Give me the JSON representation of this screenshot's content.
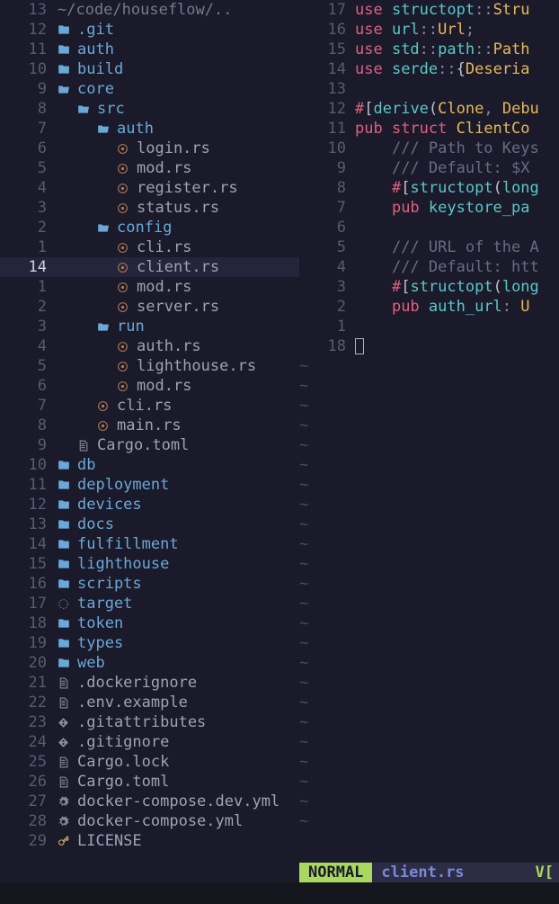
{
  "tree": {
    "header": {
      "num": "13",
      "path": "~/code/houseflow/.."
    },
    "rows": [
      {
        "num": "12",
        "indent": 0,
        "icon": "folder",
        "name": ".git",
        "cls": "folder-name"
      },
      {
        "num": "11",
        "indent": 0,
        "icon": "folder",
        "name": "auth",
        "cls": "folder-name"
      },
      {
        "num": "10",
        "indent": 0,
        "icon": "folder",
        "name": "build",
        "cls": "folder-name"
      },
      {
        "num": "9",
        "indent": 0,
        "icon": "folder-open",
        "name": "core",
        "cls": "folder-name"
      },
      {
        "num": "8",
        "indent": 1,
        "icon": "folder-open",
        "name": "src",
        "cls": "folder-name"
      },
      {
        "num": "7",
        "indent": 2,
        "icon": "folder-open",
        "name": "auth",
        "cls": "folder-name"
      },
      {
        "num": "6",
        "indent": 3,
        "icon": "rust",
        "name": "login.rs",
        "cls": "generic-name"
      },
      {
        "num": "5",
        "indent": 3,
        "icon": "rust",
        "name": "mod.rs",
        "cls": "generic-name"
      },
      {
        "num": "4",
        "indent": 3,
        "icon": "rust",
        "name": "register.rs",
        "cls": "generic-name"
      },
      {
        "num": "3",
        "indent": 3,
        "icon": "rust",
        "name": "status.rs",
        "cls": "generic-name"
      },
      {
        "num": "2",
        "indent": 2,
        "icon": "folder-open",
        "name": "config",
        "cls": "folder-name"
      },
      {
        "num": "1",
        "indent": 3,
        "icon": "rust",
        "name": "cli.rs",
        "cls": "generic-name"
      },
      {
        "num": "14",
        "indent": 3,
        "icon": "rust",
        "name": "client.rs",
        "cls": "generic-name",
        "current": true
      },
      {
        "num": "1",
        "indent": 3,
        "icon": "rust",
        "name": "mod.rs",
        "cls": "generic-name"
      },
      {
        "num": "2",
        "indent": 3,
        "icon": "rust",
        "name": "server.rs",
        "cls": "generic-name"
      },
      {
        "num": "3",
        "indent": 2,
        "icon": "folder-open",
        "name": "run",
        "cls": "folder-name"
      },
      {
        "num": "4",
        "indent": 3,
        "icon": "rust",
        "name": "auth.rs",
        "cls": "generic-name"
      },
      {
        "num": "5",
        "indent": 3,
        "icon": "rust",
        "name": "lighthouse.rs",
        "cls": "generic-name"
      },
      {
        "num": "6",
        "indent": 3,
        "icon": "rust",
        "name": "mod.rs",
        "cls": "generic-name"
      },
      {
        "num": "7",
        "indent": 2,
        "icon": "rust",
        "name": "cli.rs",
        "cls": "generic-name"
      },
      {
        "num": "8",
        "indent": 2,
        "icon": "rust",
        "name": "main.rs",
        "cls": "generic-name"
      },
      {
        "num": "9",
        "indent": 1,
        "icon": "file",
        "name": "Cargo.toml",
        "cls": "generic-name"
      },
      {
        "num": "10",
        "indent": 0,
        "icon": "folder",
        "name": "db",
        "cls": "folder-name"
      },
      {
        "num": "11",
        "indent": 0,
        "icon": "folder",
        "name": "deployment",
        "cls": "folder-name"
      },
      {
        "num": "12",
        "indent": 0,
        "icon": "folder",
        "name": "devices",
        "cls": "folder-name"
      },
      {
        "num": "13",
        "indent": 0,
        "icon": "folder",
        "name": "docs",
        "cls": "folder-name"
      },
      {
        "num": "14",
        "indent": 0,
        "icon": "folder",
        "name": "fulfillment",
        "cls": "folder-name"
      },
      {
        "num": "15",
        "indent": 0,
        "icon": "folder",
        "name": "lighthouse",
        "cls": "folder-name"
      },
      {
        "num": "16",
        "indent": 0,
        "icon": "folder",
        "name": "scripts",
        "cls": "folder-name"
      },
      {
        "num": "17",
        "indent": 0,
        "icon": "target",
        "name": "target",
        "cls": "folder-name"
      },
      {
        "num": "18",
        "indent": 0,
        "icon": "folder",
        "name": "token",
        "cls": "folder-name"
      },
      {
        "num": "19",
        "indent": 0,
        "icon": "folder",
        "name": "types",
        "cls": "folder-name"
      },
      {
        "num": "20",
        "indent": 0,
        "icon": "folder",
        "name": "web",
        "cls": "folder-name"
      },
      {
        "num": "21",
        "indent": 0,
        "icon": "file",
        "name": ".dockerignore",
        "cls": "generic-name"
      },
      {
        "num": "22",
        "indent": 0,
        "icon": "file",
        "name": ".env.example",
        "cls": "generic-name"
      },
      {
        "num": "23",
        "indent": 0,
        "icon": "git",
        "name": ".gitattributes",
        "cls": "generic-name"
      },
      {
        "num": "24",
        "indent": 0,
        "icon": "git",
        "name": ".gitignore",
        "cls": "generic-name"
      },
      {
        "num": "25",
        "indent": 0,
        "icon": "file",
        "name": "Cargo.lock",
        "cls": "generic-name"
      },
      {
        "num": "26",
        "indent": 0,
        "icon": "file",
        "name": "Cargo.toml",
        "cls": "generic-name"
      },
      {
        "num": "27",
        "indent": 0,
        "icon": "gear",
        "name": "docker-compose.dev.yml",
        "cls": "generic-name"
      },
      {
        "num": "28",
        "indent": 0,
        "icon": "gear",
        "name": "docker-compose.yml",
        "cls": "generic-name"
      },
      {
        "num": "29",
        "indent": 0,
        "icon": "key",
        "name": "LICENSE",
        "cls": "generic-name"
      }
    ]
  },
  "code": {
    "lines": [
      {
        "num": "17",
        "tokens": [
          [
            "kw-use",
            "use "
          ],
          [
            "ident",
            "structopt"
          ],
          [
            "punct",
            "::"
          ],
          [
            "type",
            "Stru"
          ]
        ]
      },
      {
        "num": "16",
        "tokens": [
          [
            "kw-use",
            "use "
          ],
          [
            "ident",
            "url"
          ],
          [
            "punct",
            "::"
          ],
          [
            "type",
            "Url"
          ],
          [
            "punct",
            ";"
          ]
        ]
      },
      {
        "num": "15",
        "tokens": [
          [
            "kw-use",
            "use "
          ],
          [
            "ident",
            "std"
          ],
          [
            "punct",
            "::"
          ],
          [
            "ident",
            "path"
          ],
          [
            "punct",
            "::"
          ],
          [
            "type",
            "Path"
          ]
        ]
      },
      {
        "num": "14",
        "tokens": [
          [
            "kw-use",
            "use "
          ],
          [
            "ident",
            "serde"
          ],
          [
            "punct",
            "::"
          ],
          [
            "brace",
            "{"
          ],
          [
            "type",
            "Deseria"
          ]
        ]
      },
      {
        "num": "13",
        "tokens": []
      },
      {
        "num": "12",
        "tokens": [
          [
            "attr-hash",
            "#"
          ],
          [
            "brace",
            "["
          ],
          [
            "attr-body",
            "derive"
          ],
          [
            "brace",
            "("
          ],
          [
            "type",
            "Clone"
          ],
          [
            "punct",
            ", "
          ],
          [
            "type",
            "Debu"
          ]
        ]
      },
      {
        "num": "11",
        "tokens": [
          [
            "kw-pub",
            "pub "
          ],
          [
            "kw-struct",
            "struct "
          ],
          [
            "type",
            "ClientCo"
          ]
        ]
      },
      {
        "num": "10",
        "tokens": [
          [
            "",
            "    "
          ],
          [
            "comment",
            "/// Path to Keys"
          ]
        ]
      },
      {
        "num": "9",
        "tokens": [
          [
            "",
            "    "
          ],
          [
            "comment",
            "/// Default: $X"
          ]
        ]
      },
      {
        "num": "8",
        "tokens": [
          [
            "",
            "    "
          ],
          [
            "attr-hash",
            "#"
          ],
          [
            "brace",
            "["
          ],
          [
            "attr-body",
            "structopt"
          ],
          [
            "brace",
            "("
          ],
          [
            "attr-body",
            "long"
          ]
        ]
      },
      {
        "num": "7",
        "tokens": [
          [
            "",
            "    "
          ],
          [
            "kw-pub",
            "pub "
          ],
          [
            "ident",
            "keystore_pa"
          ]
        ]
      },
      {
        "num": "6",
        "tokens": []
      },
      {
        "num": "5",
        "tokens": [
          [
            "",
            "    "
          ],
          [
            "comment",
            "/// URL of the A"
          ]
        ]
      },
      {
        "num": "4",
        "tokens": [
          [
            "",
            "    "
          ],
          [
            "comment",
            "/// Default: htt"
          ]
        ]
      },
      {
        "num": "3",
        "tokens": [
          [
            "",
            "    "
          ],
          [
            "attr-hash",
            "#"
          ],
          [
            "brace",
            "["
          ],
          [
            "attr-body",
            "structopt"
          ],
          [
            "brace",
            "("
          ],
          [
            "attr-body",
            "long"
          ]
        ]
      },
      {
        "num": "2",
        "tokens": [
          [
            "",
            "    "
          ],
          [
            "kw-pub",
            "pub "
          ],
          [
            "ident",
            "auth_url"
          ],
          [
            "punct",
            ": "
          ],
          [
            "type",
            "U"
          ]
        ]
      },
      {
        "num": "1",
        "tokens": []
      }
    ],
    "cursor_num": "18",
    "tilde_count": 24
  },
  "status": {
    "mode": "NORMAL",
    "filename": "client.rs",
    "right": "V["
  }
}
